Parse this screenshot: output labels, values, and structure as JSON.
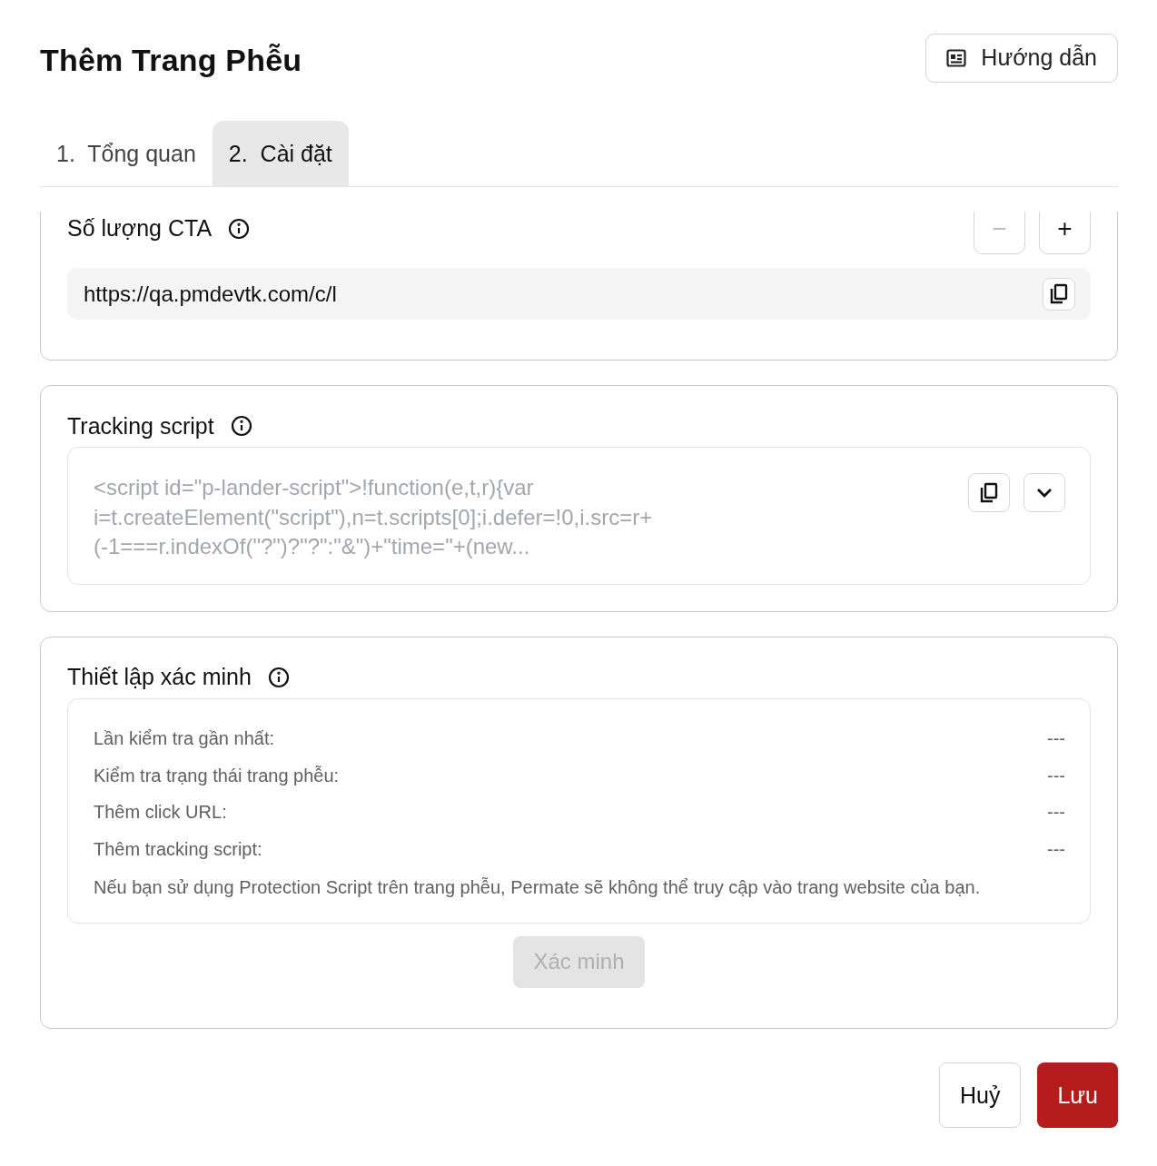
{
  "header": {
    "title": "Thêm Trang Phễu",
    "guide_button": "Hướng dẫn"
  },
  "tabs": [
    {
      "label": "1.  Tổng quan",
      "selected": false
    },
    {
      "label": "2.  Cài đặt",
      "selected": true
    }
  ],
  "cta_section": {
    "title": "Số lượng CTA",
    "decrement": {
      "label": "−",
      "disabled": true
    },
    "increment": {
      "label": "+",
      "disabled": false
    },
    "url": "https://qa.pmdevtk.com/c/l"
  },
  "tracking_section": {
    "title": "Tracking script",
    "script": "<script id=\"p-lander-script\">!function(e,t,r){var\ni=t.createElement(\"script\"),n=t.scripts[0];i.defer=!0,i.src=r+\n(-1===r.indexOf(\"?\")?\"?\":\"&\")+\"time=\"+(new..."
  },
  "verification_section": {
    "title": "Thiết lập xác minh",
    "rows": [
      {
        "label": "Lần kiểm tra gần nhất:",
        "value": "---"
      },
      {
        "label": "Kiểm tra trạng thái trang phễu:",
        "value": "---"
      },
      {
        "label": "Thêm click URL:",
        "value": "---"
      },
      {
        "label": "Thêm tracking script:",
        "value": "---"
      }
    ],
    "note": "Nếu bạn sử dụng Protection Script trên trang phễu, Permate sẽ không thể truy cập vào trang website của bạn.",
    "verify_button": {
      "label": "Xác minh",
      "disabled": true
    }
  },
  "footer": {
    "cancel": "Huỷ",
    "save": "Lưu"
  }
}
